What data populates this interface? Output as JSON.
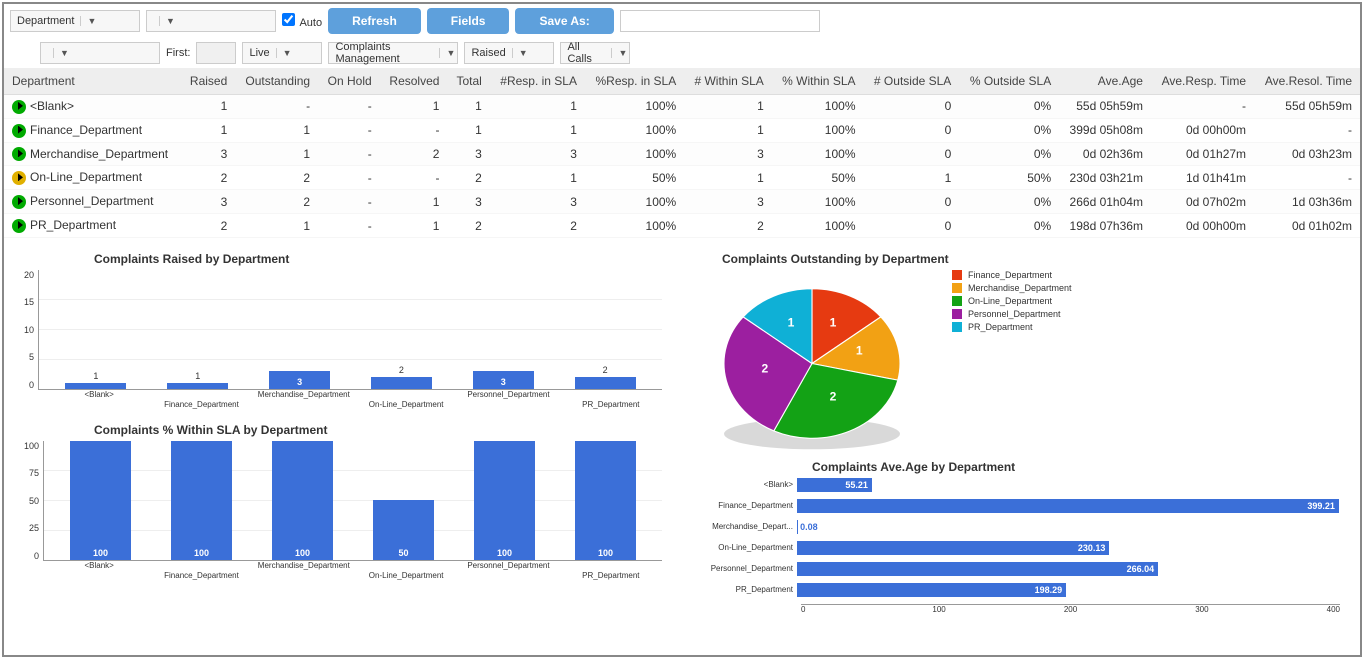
{
  "toolbar": {
    "group_by": "Department",
    "auto_label": "Auto",
    "auto_checked": true,
    "refresh": "Refresh",
    "fields": "Fields",
    "save_as": "Save As:",
    "save_as_value": ""
  },
  "filters": {
    "first_label": "First:",
    "first_value": "",
    "mode": "Live",
    "service": "Complaints Management",
    "status": "Raised",
    "calls": "All Calls"
  },
  "columns": [
    "Department",
    "Raised",
    "Outstanding",
    "On Hold",
    "Resolved",
    "Total",
    "#Resp. in SLA",
    "%Resp. in SLA",
    "# Within SLA",
    "% Within SLA",
    "# Outside SLA",
    "% Outside SLA",
    "Ave.Age",
    "Ave.Resp. Time",
    "Ave.Resol. Time"
  ],
  "rows": [
    {
      "icon": "green",
      "dept": "<Blank>",
      "raised": "1",
      "outstanding": "-",
      "onhold": "-",
      "resolved": "1",
      "total": "1",
      "resp_in": "1",
      "resp_pct": "100%",
      "within": "1",
      "within_pct": "100%",
      "outside": "0",
      "outside_pct": "0%",
      "age": "55d 05h59m",
      "resp_time": "-",
      "resol_time": "55d 05h59m"
    },
    {
      "icon": "green",
      "dept": "Finance_Department",
      "raised": "1",
      "outstanding": "1",
      "onhold": "-",
      "resolved": "-",
      "total": "1",
      "resp_in": "1",
      "resp_pct": "100%",
      "within": "1",
      "within_pct": "100%",
      "outside": "0",
      "outside_pct": "0%",
      "age": "399d 05h08m",
      "resp_time": "0d 00h00m",
      "resol_time": "-"
    },
    {
      "icon": "green",
      "dept": "Merchandise_Department",
      "raised": "3",
      "outstanding": "1",
      "onhold": "-",
      "resolved": "2",
      "total": "3",
      "resp_in": "3",
      "resp_pct": "100%",
      "within": "3",
      "within_pct": "100%",
      "outside": "0",
      "outside_pct": "0%",
      "age": "0d 02h36m",
      "resp_time": "0d 01h27m",
      "resol_time": "0d 03h23m"
    },
    {
      "icon": "amber",
      "dept": "On-Line_Department",
      "raised": "2",
      "outstanding": "2",
      "onhold": "-",
      "resolved": "-",
      "total": "2",
      "resp_in": "1",
      "resp_pct": "50%",
      "within": "1",
      "within_pct": "50%",
      "outside": "1",
      "outside_pct": "50%",
      "age": "230d 03h21m",
      "resp_time": "1d 01h41m",
      "resol_time": "-"
    },
    {
      "icon": "green",
      "dept": "Personnel_Department",
      "raised": "3",
      "outstanding": "2",
      "onhold": "-",
      "resolved": "1",
      "total": "3",
      "resp_in": "3",
      "resp_pct": "100%",
      "within": "3",
      "within_pct": "100%",
      "outside": "0",
      "outside_pct": "0%",
      "age": "266d 01h04m",
      "resp_time": "0d 07h02m",
      "resol_time": "1d 03h36m"
    },
    {
      "icon": "green",
      "dept": "PR_Department",
      "raised": "2",
      "outstanding": "1",
      "onhold": "-",
      "resolved": "1",
      "total": "2",
      "resp_in": "2",
      "resp_pct": "100%",
      "within": "2",
      "within_pct": "100%",
      "outside": "0",
      "outside_pct": "0%",
      "age": "198d 07h36m",
      "resp_time": "0d 00h00m",
      "resol_time": "0d 01h02m"
    }
  ],
  "chart_data": [
    {
      "id": "raised",
      "type": "bar",
      "title": "Complaints Raised by Department",
      "categories": [
        "<Blank>",
        "Finance_Department",
        "Merchandise_Department",
        "On-Line_Department",
        "Personnel_Department",
        "PR_Department"
      ],
      "values": [
        1,
        1,
        3,
        2,
        3,
        2
      ],
      "ylim": [
        0,
        20
      ],
      "yticks": [
        0,
        5,
        10,
        15,
        20
      ]
    },
    {
      "id": "outstanding_pie",
      "type": "pie",
      "title": "Complaints Outstanding by Department",
      "categories": [
        "Finance_Department",
        "Merchandise_Department",
        "On-Line_Department",
        "Personnel_Department",
        "PR_Department"
      ],
      "values": [
        1,
        1,
        2,
        2,
        1
      ],
      "colors": [
        "#e63a11",
        "#f2a114",
        "#13a215",
        "#9c1fa0",
        "#0fb0d6"
      ]
    },
    {
      "id": "within_sla",
      "type": "bar",
      "title": "Complaints % Within SLA by Department",
      "categories": [
        "<Blank>",
        "Finance_Department",
        "Merchandise_Department",
        "On-Line_Department",
        "Personnel_Department",
        "PR_Department"
      ],
      "values": [
        100,
        100,
        100,
        50,
        100,
        100
      ],
      "ylim": [
        0,
        100
      ],
      "yticks": [
        0,
        25,
        50,
        75,
        100
      ]
    },
    {
      "id": "avg_age",
      "type": "bar_horizontal",
      "title": "Complaints Ave.Age by Department",
      "categories": [
        "<Blank>",
        "Finance_Department",
        "Merchandise_Depart...",
        "On-Line_Department",
        "Personnel_Department",
        "PR_Department"
      ],
      "values": [
        55.21,
        399.21,
        0.08,
        230.13,
        266.04,
        198.29
      ],
      "xlim": [
        0,
        400
      ],
      "xticks": [
        0,
        100,
        200,
        300,
        400
      ]
    }
  ]
}
